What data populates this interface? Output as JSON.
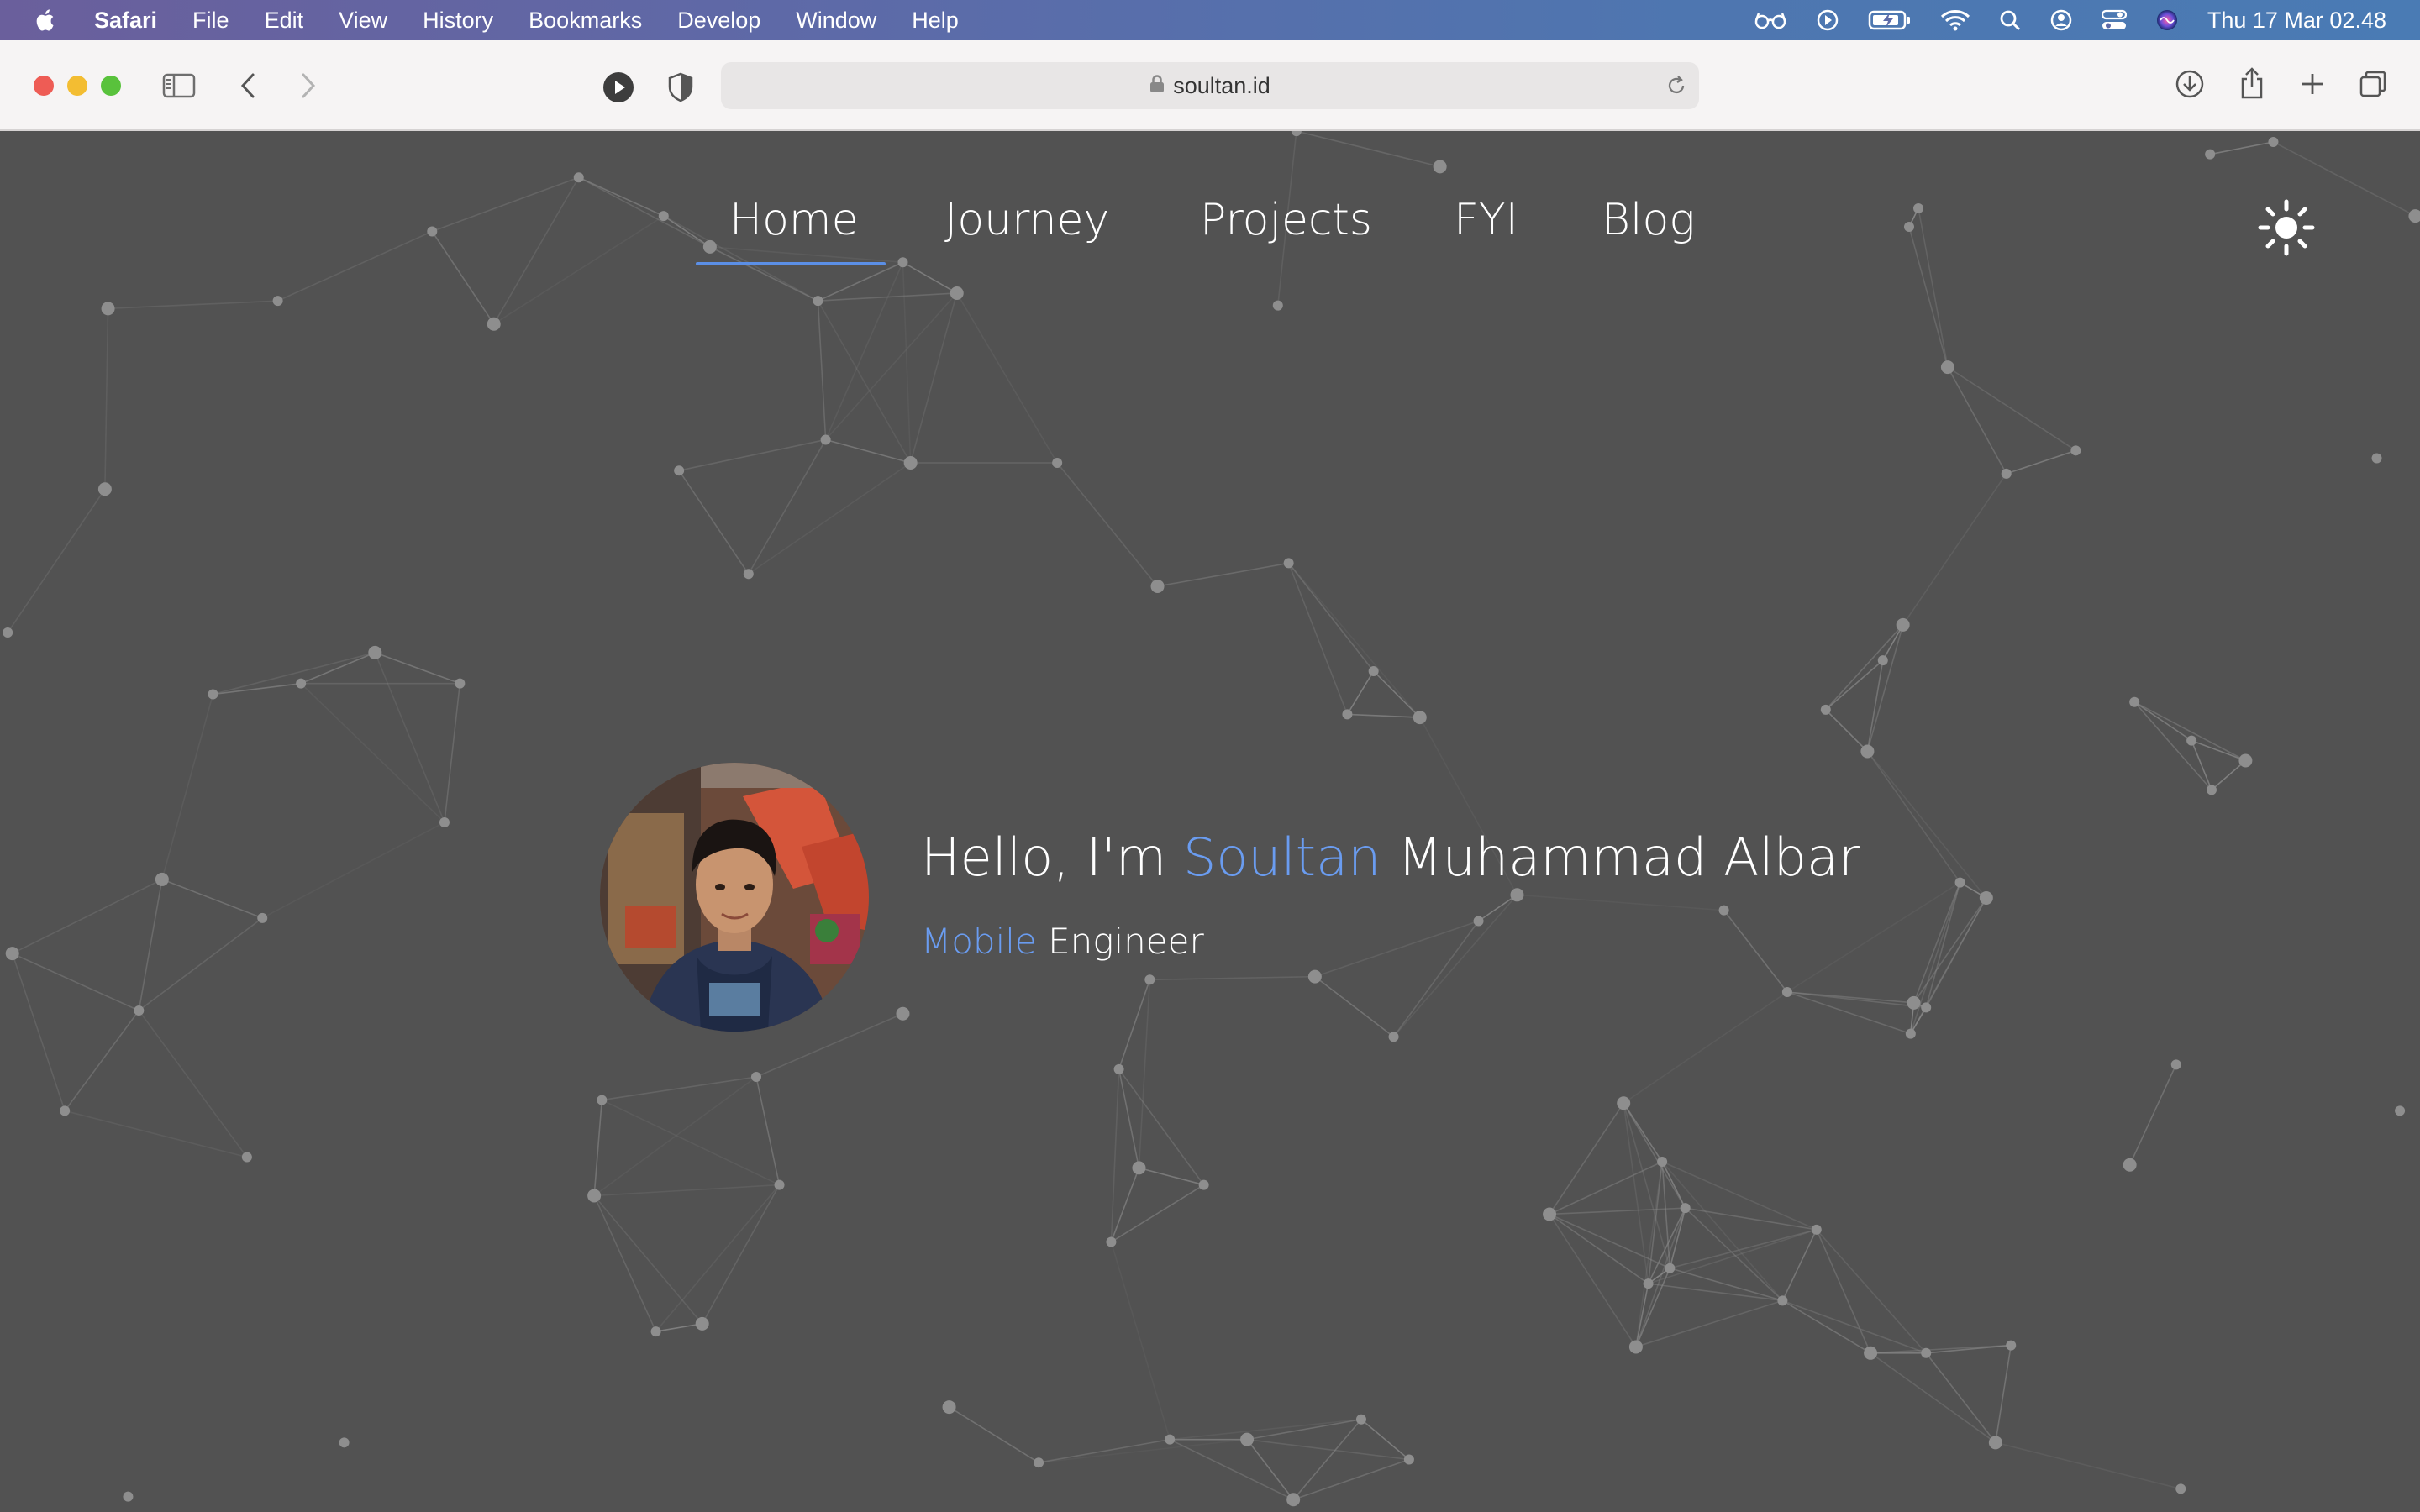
{
  "menubar": {
    "app": "Safari",
    "items": [
      "File",
      "Edit",
      "View",
      "History",
      "Bookmarks",
      "Develop",
      "Window",
      "Help"
    ],
    "clock": "Thu 17 Mar  02.48"
  },
  "browser": {
    "url": "soultan.id"
  },
  "nav": {
    "items": [
      "Home",
      "Journey",
      "Projects",
      "FYI",
      "Blog"
    ],
    "active": "Home"
  },
  "hero": {
    "greeting": "Hello, I'm ",
    "first_name": "Soultan",
    "rest_name": " Muhammad Albar",
    "role_accent": "Mobile",
    "role_rest": " Engineer"
  },
  "colors": {
    "page_bg": "#525252",
    "accent": "#6a9cf0",
    "underline": "#5b8fe6"
  },
  "icons": {
    "theme_toggle": "sun-icon"
  }
}
